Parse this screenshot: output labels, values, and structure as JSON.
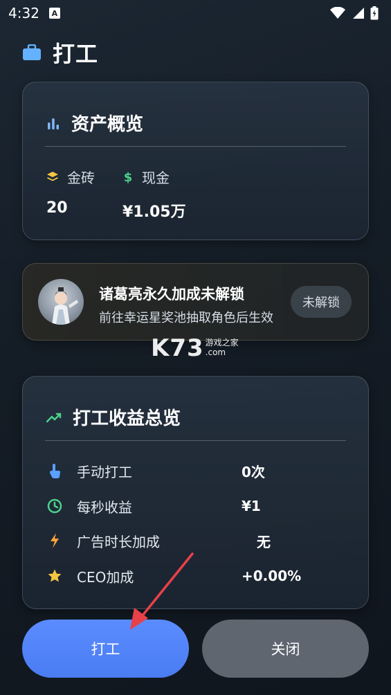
{
  "status_bar": {
    "time": "4:32",
    "notification_icon": "A"
  },
  "header": {
    "title": "打工",
    "icon": "briefcase-icon"
  },
  "assets_card": {
    "title": "资产概览",
    "gold": {
      "label": "金砖",
      "value": "20"
    },
    "cash": {
      "label": "现金",
      "value": "¥1.05万"
    }
  },
  "unlock_card": {
    "title": "诸葛亮永久加成未解锁",
    "subtitle": "前往幸运星奖池抽取角色后生效",
    "badge": "未解锁"
  },
  "watermark": {
    "main": "K73",
    "side_top": "游戏之家",
    "side_bottom": ".com"
  },
  "earnings_card": {
    "title": "打工收益总览",
    "rows": [
      {
        "label": "手动打工",
        "value": "0次",
        "icon": "tap-hand-icon"
      },
      {
        "label": "每秒收益",
        "value": "¥1",
        "icon": "clock-icon"
      },
      {
        "label": "广告时长加成",
        "value": "无",
        "icon": "lightning-icon"
      },
      {
        "label": "CEO加成",
        "value": "+0.00%",
        "icon": "star-icon"
      }
    ]
  },
  "buttons": {
    "work": "打工",
    "close": "关闭"
  },
  "colors": {
    "accent_blue": "#4a7cf2",
    "close_gray": "#5f6670",
    "trend_green": "#4cd28a",
    "gold_yellow": "#f4c542",
    "arrow_red": "#e8414a"
  }
}
